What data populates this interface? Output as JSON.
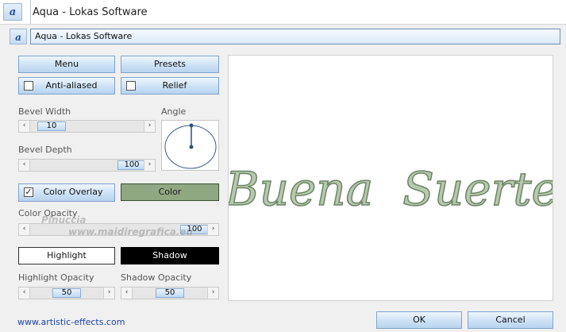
{
  "window": {
    "title": "Aqua - Lokas Software"
  },
  "app": {
    "name": "Aqua - Lokas Software"
  },
  "buttons": {
    "menu": "Menu",
    "presets": "Presets",
    "anti_aliased": "Anti-aliased",
    "relief": "Relief",
    "color_overlay": "Color Overlay",
    "color": "Color",
    "highlight": "Highlight",
    "shadow": "Shadow",
    "ok": "OK",
    "cancel": "Cancel"
  },
  "checks": {
    "anti_aliased": false,
    "relief": false,
    "color_overlay": true
  },
  "labels": {
    "bevel_width": "Bevel Width",
    "angle": "Angle",
    "bevel_depth": "Bevel Depth",
    "color_opacity": "Color Opacity",
    "highlight_opacity": "Highlight Opacity",
    "shadow_opacity": "Shadow Opacity"
  },
  "values": {
    "bevel_width": "10",
    "bevel_depth": "100",
    "color_opacity": "100",
    "highlight_opacity": "50",
    "shadow_opacity": "50"
  },
  "colors": {
    "overlay": "#8fa882",
    "highlight_swatch": "#ffffff",
    "shadow_swatch": "#000000",
    "text_fill": "#b7c8ae",
    "text_stroke": "#6d8566"
  },
  "preview": {
    "text": "Buena  Suerte"
  },
  "watermark": {
    "line1": "Pinuccia",
    "line2": "www.maidiregrafica.eu"
  },
  "footer": {
    "link": "www.artistic-effects.com"
  }
}
